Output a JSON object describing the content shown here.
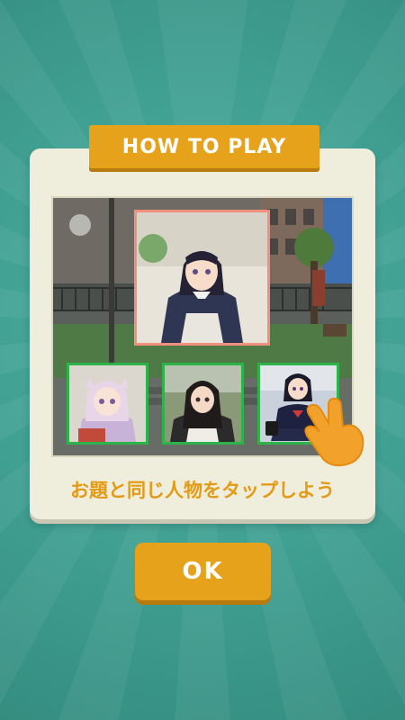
{
  "dialog": {
    "title": "HOW TO PLAY",
    "instruction": "お題と同じ人物をタップしよう",
    "ok_label": "OK"
  },
  "example": {
    "target": "target-character-portrait",
    "choices": [
      "choice-character-pink-hair",
      "choice-character-black-long-hair",
      "choice-character-sailor-uniform"
    ],
    "correct_choice_index": 2,
    "pointer": "tap-hand-icon"
  },
  "colors": {
    "background": "#3f9f91",
    "accent": "#e6a21a",
    "panel": "#efeedd",
    "choice_border": "#2db34a",
    "target_border": "#f28f7e",
    "instruction_text": "#e39a15"
  }
}
